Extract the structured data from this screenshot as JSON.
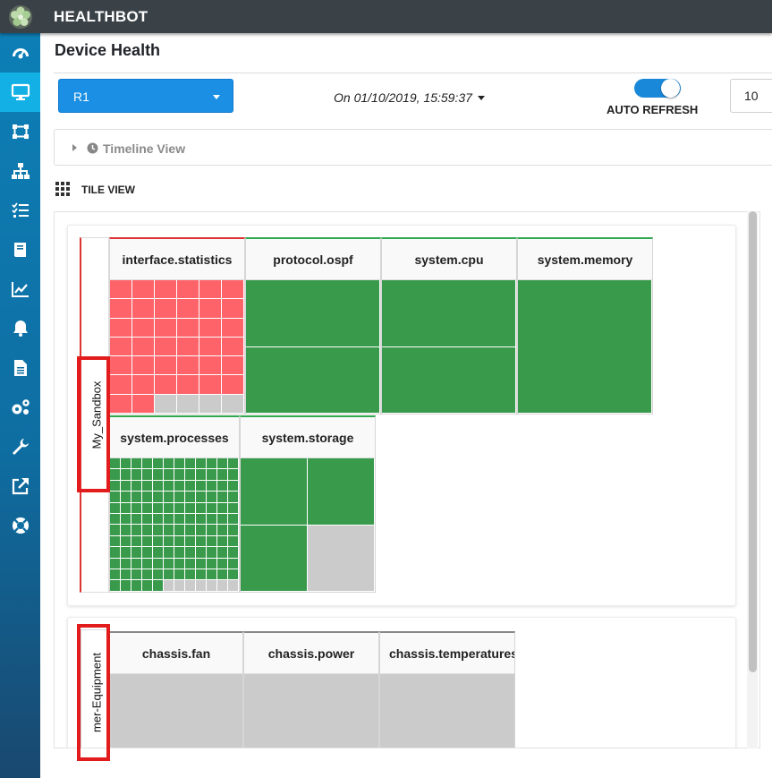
{
  "app": {
    "title": "HEALTHBOT"
  },
  "sidebar": {
    "items": [
      {
        "icon": "dashboard-gauge-icon",
        "active": false
      },
      {
        "icon": "monitor-icon",
        "active": true
      },
      {
        "icon": "network-graph-icon",
        "active": false
      },
      {
        "icon": "hierarchy-icon",
        "active": false
      },
      {
        "icon": "checklist-icon",
        "active": false
      },
      {
        "icon": "book-icon",
        "active": false
      },
      {
        "icon": "chart-line-icon",
        "active": false
      },
      {
        "icon": "bell-icon",
        "active": false
      },
      {
        "icon": "document-icon",
        "active": false
      },
      {
        "icon": "gears-icon",
        "active": false
      },
      {
        "icon": "wrench-icon",
        "active": false
      },
      {
        "icon": "external-link-icon",
        "active": false
      },
      {
        "icon": "lifebuoy-icon",
        "active": false
      }
    ]
  },
  "page": {
    "title": "Device Health"
  },
  "controls": {
    "device_selected": "R1",
    "timestamp": "On 01/10/2019, 15:59:37",
    "auto_refresh_label": "AUTO REFRESH",
    "auto_refresh_on": true,
    "refresh_interval": "10"
  },
  "timeline": {
    "label": "Timeline View",
    "expanded": false
  },
  "tile_view": {
    "label": "TILE VIEW"
  },
  "colors": {
    "red": "#fd6369",
    "green": "#3a9a4c",
    "grey": "#cbcbcb",
    "accent": "#1a8fe3"
  },
  "groups": [
    {
      "name": "My_Sandbox",
      "tiles": [
        {
          "title": "interface.statistics",
          "status": "red",
          "cols": 6,
          "rows": 7,
          "red_cells": 38,
          "grey_cells": 4
        },
        {
          "title": "protocol.ospf",
          "status": "green",
          "cols": 1,
          "rows": 2,
          "green_cells": 2
        },
        {
          "title": "system.cpu",
          "status": "green",
          "cols": 1,
          "rows": 2,
          "green_cells": 2
        },
        {
          "title": "system.memory",
          "status": "green",
          "cols": 1,
          "rows": 1,
          "green_cells": 1
        },
        {
          "title": "system.processes",
          "status": "green",
          "cols": 12,
          "rows": 12,
          "green_cells": 137,
          "grey_cells": 7
        },
        {
          "title": "system.storage",
          "status": "green",
          "cols": 2,
          "rows": 2,
          "green_cells": 3,
          "grey_cells": 1
        }
      ]
    },
    {
      "name": "mer-Equipment",
      "tiles": [
        {
          "title": "chassis.fan",
          "status": "none"
        },
        {
          "title": "chassis.power",
          "status": "none"
        },
        {
          "title": "chassis.temperatures",
          "status": "none"
        }
      ]
    }
  ]
}
